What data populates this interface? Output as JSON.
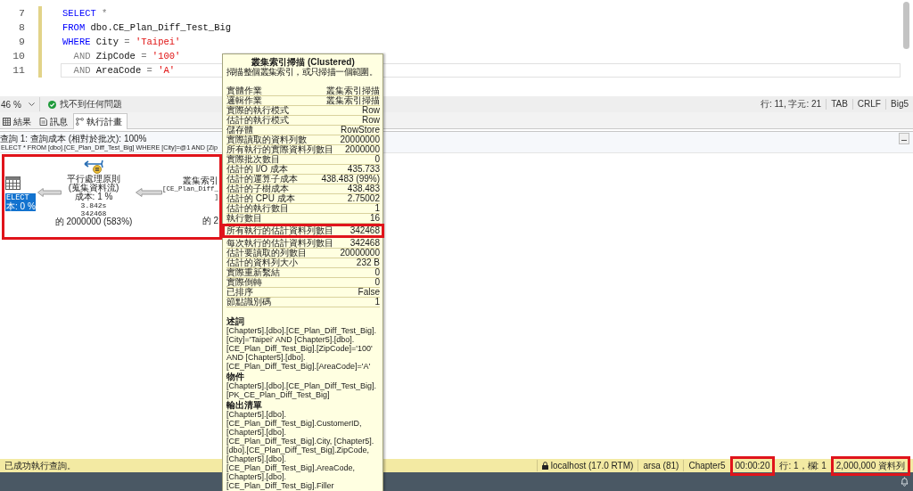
{
  "editor": {
    "lines": [
      {
        "number": "7",
        "changed": true,
        "current": false,
        "tokens": [
          {
            "kind": "keyword",
            "text": "SELECT"
          },
          {
            "kind": "operator",
            "text": " *"
          }
        ]
      },
      {
        "number": "8",
        "changed": true,
        "current": false,
        "tokens": [
          {
            "kind": "keyword",
            "text": "FROM"
          },
          {
            "kind": "plain",
            "text": " dbo.CE_Plan_Diff_Test_Big"
          }
        ]
      },
      {
        "number": "9",
        "changed": true,
        "current": false,
        "tokens": [
          {
            "kind": "keyword",
            "text": "WHERE"
          },
          {
            "kind": "plain",
            "text": " City"
          },
          {
            "kind": "operator",
            "text": " ="
          },
          {
            "kind": "string",
            "text": " 'Taipei'"
          }
        ]
      },
      {
        "number": "10",
        "changed": true,
        "current": false,
        "tokens": [
          {
            "kind": "operator",
            "text": "  AND"
          },
          {
            "kind": "plain",
            "text": " ZipCode"
          },
          {
            "kind": "operator",
            "text": " ="
          },
          {
            "kind": "string",
            "text": " '100'"
          }
        ]
      },
      {
        "number": "11",
        "changed": true,
        "current": true,
        "tokens": [
          {
            "kind": "operator",
            "text": "  AND"
          },
          {
            "kind": "plain",
            "text": " AreaCode"
          },
          {
            "kind": "operator",
            "text": " ="
          },
          {
            "kind": "string",
            "text": " 'A'"
          }
        ]
      }
    ]
  },
  "editor_status": {
    "zoom": "46 %",
    "issues": "找不到任何問題",
    "position": "行: 11, 字元: 21",
    "indent": "TAB",
    "line_ending": "CRLF",
    "encoding": "Big5"
  },
  "result_tabs": [
    {
      "kind": "grid",
      "label": "結果",
      "selected": false
    },
    {
      "kind": "messages",
      "label": "訊息",
      "selected": false
    },
    {
      "kind": "plan",
      "label": "執行計畫",
      "selected": true
    }
  ],
  "plan": {
    "cost_header": "查詢 1: 查詢成本 (相對於批次): 100%",
    "query_text": "ELECT * FROM [dbo].[CE_Plan_Diff_Test_Big] WHERE [City]=@1 AND [Zip",
    "highlighted": true,
    "nodes": [
      {
        "kind": "select",
        "title": "ELECT",
        "cost": "本: 0 %",
        "selected": true
      },
      {
        "kind": "parallelism",
        "title": "平行處理原則",
        "subtitle_lines": [
          "(蒐集資料流)"
        ],
        "cost": "成本: 1 %",
        "time": "3.842s",
        "rows": "342468",
        "estimate": "的 2000000 (583%)",
        "selected": false
      },
      {
        "kind": "index_scan",
        "title": "叢集索引",
        "subtitle_lines": [
          "[CE_Plan_Diff_",
          "]"
        ],
        "estimate": "的 2",
        "selected": false
      }
    ]
  },
  "tooltip": {
    "title": "叢集索引掃描 (Clustered)",
    "description": "掃描整個叢集索引，或只掃描一個範圍。",
    "properties": [
      {
        "label": "實體作業",
        "value": "叢集索引掃描",
        "highlighted": false
      },
      {
        "label": "邏輯作業",
        "value": "叢集索引掃描",
        "highlighted": false
      },
      {
        "label": "實際的執行模式",
        "value": "Row",
        "highlighted": false
      },
      {
        "label": "估計的執行模式",
        "value": "Row",
        "highlighted": false
      },
      {
        "label": "儲存體",
        "value": "RowStore",
        "highlighted": false
      },
      {
        "label": "實際讀取的資料列數",
        "value": "20000000",
        "highlighted": false
      },
      {
        "label": "所有執行的實際資料列數目",
        "value": "2000000",
        "highlighted": false
      },
      {
        "label": "實際批次數目",
        "value": "0",
        "highlighted": false
      },
      {
        "label": "估計的 I/O 成本",
        "value": "435.733",
        "highlighted": false
      },
      {
        "label": "估計的運算子成本",
        "value": "438.483 (99%)",
        "highlighted": false
      },
      {
        "label": "估計的子樹成本",
        "value": "438.483",
        "highlighted": false
      },
      {
        "label": "估計的 CPU 成本",
        "value": "2.75002",
        "highlighted": false
      },
      {
        "label": "估計的執行數目",
        "value": "1",
        "highlighted": false
      },
      {
        "label": "執行數目",
        "value": "16",
        "highlighted": false
      },
      {
        "label": "所有執行的估計資料列數目",
        "value": "342468",
        "highlighted": true
      },
      {
        "label": "每次執行的估計資料列數目",
        "value": "342468",
        "highlighted": false
      },
      {
        "label": "估計要讀取的列數目",
        "value": "20000000",
        "highlighted": false
      },
      {
        "label": "估計的資料列大小",
        "value": "232 B",
        "highlighted": false
      },
      {
        "label": "實際重新繫結",
        "value": "0",
        "highlighted": false
      },
      {
        "label": "實際倒轉",
        "value": "0",
        "highlighted": false
      },
      {
        "label": "已排序",
        "value": "False",
        "highlighted": false
      },
      {
        "label": "節點識別碼",
        "value": "1",
        "highlighted": false
      }
    ],
    "sections": [
      {
        "heading": "述詞",
        "text": "[Chapter5].[dbo].[CE_Plan_Diff_Test_Big].[City]='Taipei' AND [Chapter5].[dbo].[CE_Plan_Diff_Test_Big].[ZipCode]='100' AND [Chapter5].[dbo].[CE_Plan_Diff_Test_Big].[AreaCode]='A'"
      },
      {
        "heading": "物件",
        "text": "[Chapter5].[dbo].[CE_Plan_Diff_Test_Big].[PK_CE_Plan_Diff_Test_Big]"
      },
      {
        "heading": "輸出清單",
        "text": "[Chapter5].[dbo].[CE_Plan_Diff_Test_Big].CustomerID, [Chapter5].[dbo].[CE_Plan_Diff_Test_Big].City, [Chapter5].[dbo].[CE_Plan_Diff_Test_Big].ZipCode, [Chapter5].[dbo].[CE_Plan_Diff_Test_Big].AreaCode, [Chapter5].[dbo].[CE_Plan_Diff_Test_Big].Filler"
      }
    ]
  },
  "query_status": {
    "message": "已成功執行查詢。",
    "items": [
      {
        "kind": "server",
        "text": "localhost (17.0 RTM)",
        "highlighted": false
      },
      {
        "kind": "login",
        "text": "arsa (81)",
        "highlighted": false
      },
      {
        "kind": "database",
        "text": "Chapter5",
        "highlighted": false
      },
      {
        "kind": "elapsed",
        "text": "00:00:20",
        "highlighted": true
      },
      {
        "kind": "position",
        "text": "行: 1，欄: 1",
        "highlighted": false
      },
      {
        "kind": "rows",
        "text": "2,000,000 資料列",
        "highlighted": true
      }
    ]
  }
}
